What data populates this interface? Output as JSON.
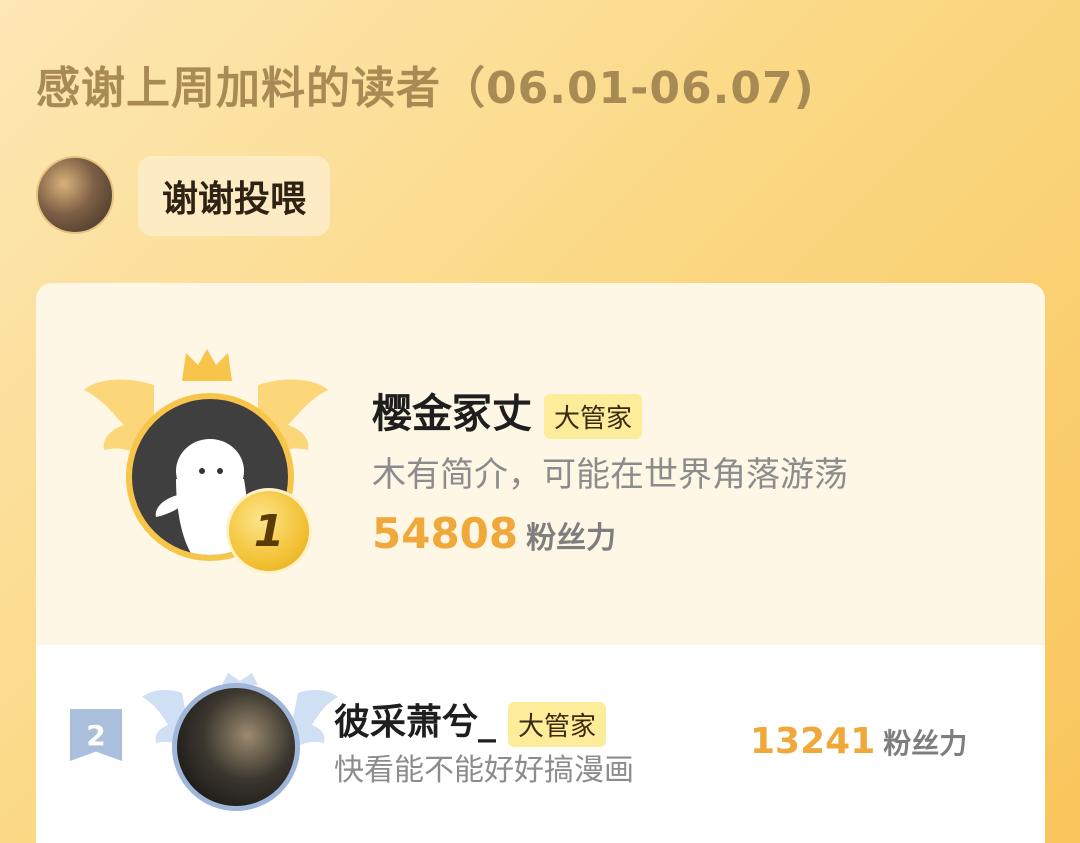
{
  "header": {
    "title": "感谢上周加料的读者（06.01-06.07)"
  },
  "thanks": {
    "avatar_icon": "uploader-avatar",
    "message": "谢谢投喂"
  },
  "ranking": [
    {
      "rank": "1",
      "name": "樱金冢丈",
      "tag": "大管家",
      "bio": "木有简介，可能在世界角落游荡",
      "fan_power": "54808",
      "fan_power_unit": "粉丝力"
    },
    {
      "rank": "2",
      "name": "彼采萧兮_",
      "tag": "大管家",
      "bio": "快看能不能好好搞漫画",
      "fan_power": "13241",
      "fan_power_unit": "粉丝力"
    }
  ],
  "colors": {
    "gold": "#f6c54a",
    "fan_power": "#f0a83a",
    "silver": "#a9bfdc",
    "tag_bg": "#fdec9a"
  }
}
